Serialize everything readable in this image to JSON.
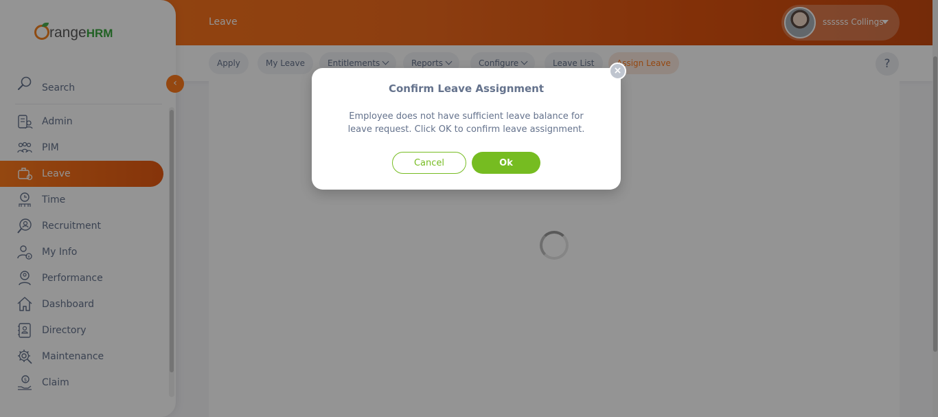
{
  "header": {
    "module_title": "Leave",
    "user_name": "ssssss Collings"
  },
  "subnav": {
    "items": [
      {
        "label": "Apply"
      },
      {
        "label": "My Leave"
      },
      {
        "label": "Entitlements"
      },
      {
        "label": "Reports"
      },
      {
        "label": "Configure"
      },
      {
        "label": "Leave List"
      },
      {
        "label": "Assign Leave"
      }
    ],
    "help_label": "?"
  },
  "brand": {
    "logo_text": "range",
    "logo_suffix": "HRM",
    "accent": "#ff7b1d",
    "success": "#76bc21"
  },
  "sidebar": {
    "search_label": "Search",
    "collapse_label": "‹",
    "items": [
      {
        "label": "Admin",
        "icon": "admin-icon"
      },
      {
        "label": "PIM",
        "icon": "pim-icon"
      },
      {
        "label": "Leave",
        "icon": "leave-icon",
        "active": true
      },
      {
        "label": "Time",
        "icon": "time-icon"
      },
      {
        "label": "Recruitment",
        "icon": "recruitment-icon"
      },
      {
        "label": "My Info",
        "icon": "my-info-icon"
      },
      {
        "label": "Performance",
        "icon": "performance-icon"
      },
      {
        "label": "Dashboard",
        "icon": "dashboard-icon"
      },
      {
        "label": "Directory",
        "icon": "directory-icon"
      },
      {
        "label": "Maintenance",
        "icon": "maintenance-icon"
      },
      {
        "label": "Claim",
        "icon": "claim-icon"
      }
    ]
  },
  "dialog": {
    "title": "Confirm Leave Assignment",
    "message": "Employee does not have sufficient leave balance for leave request. Click OK to confirm leave assignment.",
    "cancel_label": "Cancel",
    "ok_label": "Ok",
    "close_label": "×"
  }
}
